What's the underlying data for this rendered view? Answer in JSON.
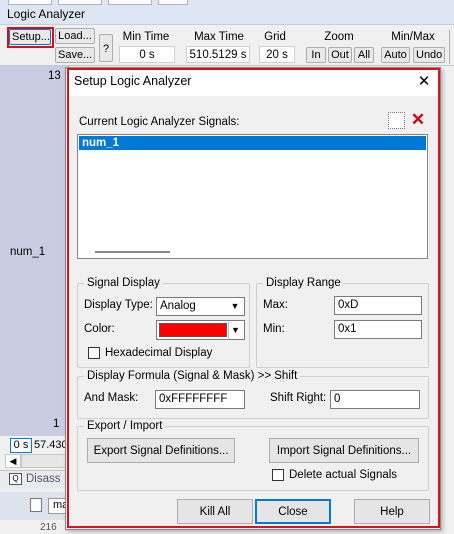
{
  "window": {
    "title": "Logic Analyzer"
  },
  "toolbar": {
    "setup": "Setup...",
    "load": "Load...",
    "save": "Save...",
    "help": "?",
    "min_time_label": "Min Time",
    "min_time_value": "0 s",
    "max_time_label": "Max Time",
    "max_time_value": "510.5129 s",
    "grid_label": "Grid",
    "grid_value": "20 s",
    "zoom_label": "Zoom",
    "zoom_in": "In",
    "zoom_out": "Out",
    "zoom_all": "All",
    "minmax_label": "Min/Max",
    "auto": "Auto",
    "undo": "Undo"
  },
  "signal_panel": {
    "top_value": "13",
    "signal_name": "num_1",
    "bottom_value": "1",
    "time_start": "0 s",
    "time_value": "57.430",
    "disassembly_tab": "Disass",
    "bottom_tab": "ma",
    "bottom_row": "216"
  },
  "dialog": {
    "title": "Setup Logic Analyzer",
    "signals_label": "Current Logic Analyzer Signals:",
    "signals": [
      "num_1"
    ],
    "signal_display_legend": "Signal Display",
    "display_type_label": "Display Type:",
    "display_type_value": "Analog",
    "color_label": "Color:",
    "color_value": "#ff0000",
    "hex_display_label": "Hexadecimal Display",
    "hex_display_checked": false,
    "display_range_legend": "Display Range",
    "max_label": "Max:",
    "max_value": "0xD",
    "min_label": "Min:",
    "min_value": "0x1",
    "formula_legend": "Display Formula (Signal & Mask) >> Shift",
    "and_mask_label": "And Mask:",
    "and_mask_value": "0xFFFFFFFF",
    "shift_right_label": "Shift Right:",
    "shift_right_value": "0",
    "export_import_legend": "Export / Import",
    "export_button": "Export Signal Definitions...",
    "import_button": "Import Signal Definitions...",
    "delete_signals_label": "Delete actual Signals",
    "delete_signals_checked": false,
    "kill_all": "Kill All",
    "close": "Close",
    "help": "Help"
  }
}
